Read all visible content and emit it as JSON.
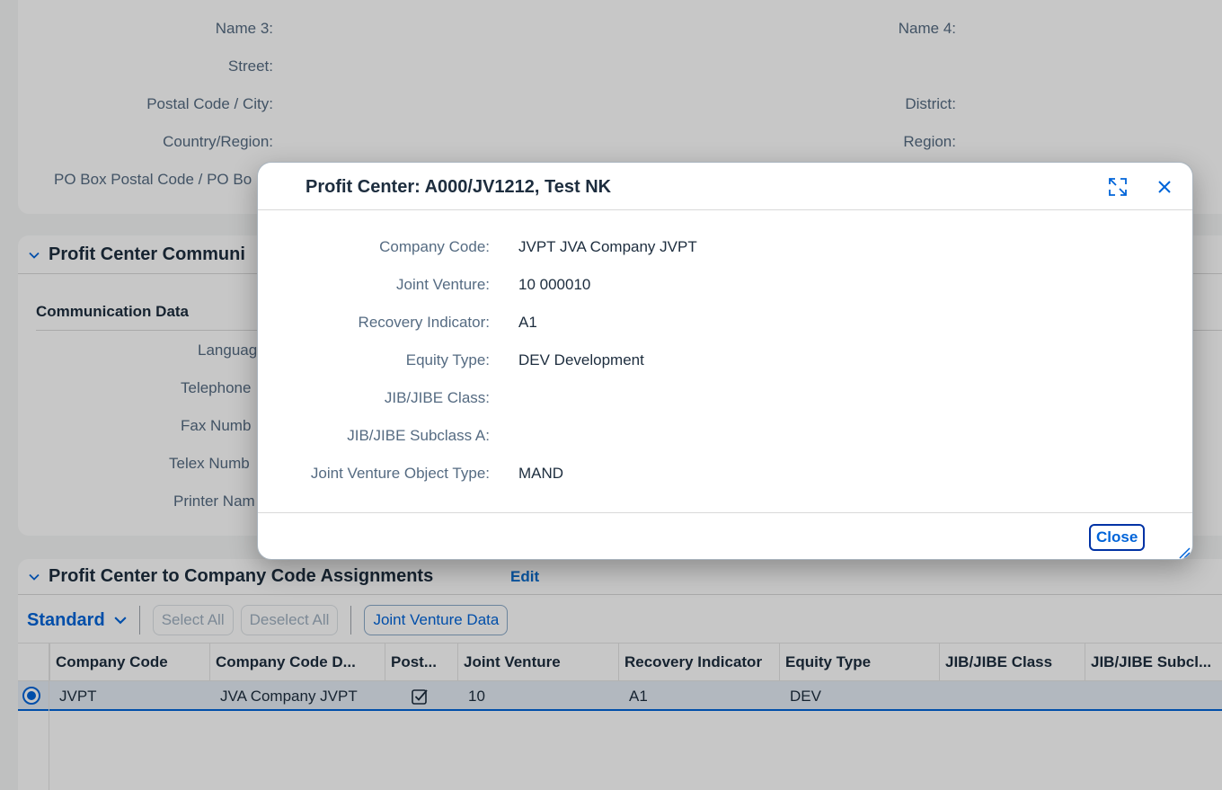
{
  "address_section": {
    "fields": [
      {
        "label": "Name 3:"
      },
      {
        "label": "Street:"
      },
      {
        "label": "Postal Code / City:"
      },
      {
        "label": "Country/Region:"
      },
      {
        "label": "PO Box Postal Code / PO Bo"
      }
    ],
    "right_fields": [
      {
        "label": "Name 4:"
      },
      {
        "label": "District:"
      },
      {
        "label": "Region:"
      }
    ]
  },
  "communication_section": {
    "title": "Profit Center Communi",
    "group_title": "Communication Data",
    "fields": [
      {
        "label": "Languag"
      },
      {
        "label": "Telephone"
      },
      {
        "label": "Fax Numb"
      },
      {
        "label": "Telex Numb"
      },
      {
        "label": "Printer Nam"
      }
    ]
  },
  "assignments_section": {
    "title": "Profit Center to Company Code Assignments",
    "edit_label": "Edit",
    "toolbar": {
      "variant": "Standard",
      "select_all": "Select All",
      "deselect_all": "Deselect All",
      "joint_venture_data": "Joint Venture Data"
    },
    "columns": [
      "Company Code",
      "Company Code D...",
      "Post...",
      "Joint Venture",
      "Recovery Indicator",
      "Equity Type",
      "JIB/JIBE Class",
      "JIB/JIBE Subcl..."
    ],
    "rows": [
      {
        "company_code": "JVPT",
        "company_code_desc": "JVA Company JVPT",
        "posting_checked": true,
        "joint_venture": "10",
        "recovery_indicator": "A1",
        "equity_type": "DEV",
        "jib_class": "",
        "jib_subclass": ""
      }
    ]
  },
  "dialog": {
    "title": "Profit Center: A000/JV1212, Test NK",
    "fields": [
      {
        "label": "Company Code:",
        "value": "JVPT JVA Company JVPT"
      },
      {
        "label": "Joint Venture:",
        "value": "10 000010"
      },
      {
        "label": "Recovery Indicator:",
        "value": "A1"
      },
      {
        "label": "Equity Type:",
        "value": "DEV Development"
      },
      {
        "label": "JIB/JIBE Class:",
        "value": ""
      },
      {
        "label": "JIB/JIBE Subclass A:",
        "value": ""
      },
      {
        "label": "Joint Venture Object Type:",
        "value": "MAND"
      }
    ],
    "close_label": "Close"
  },
  "colors": {
    "accent": "#0064d9",
    "label": "#556b82",
    "text": "#1d2d3e",
    "selected_row": "#e4ecf5"
  }
}
